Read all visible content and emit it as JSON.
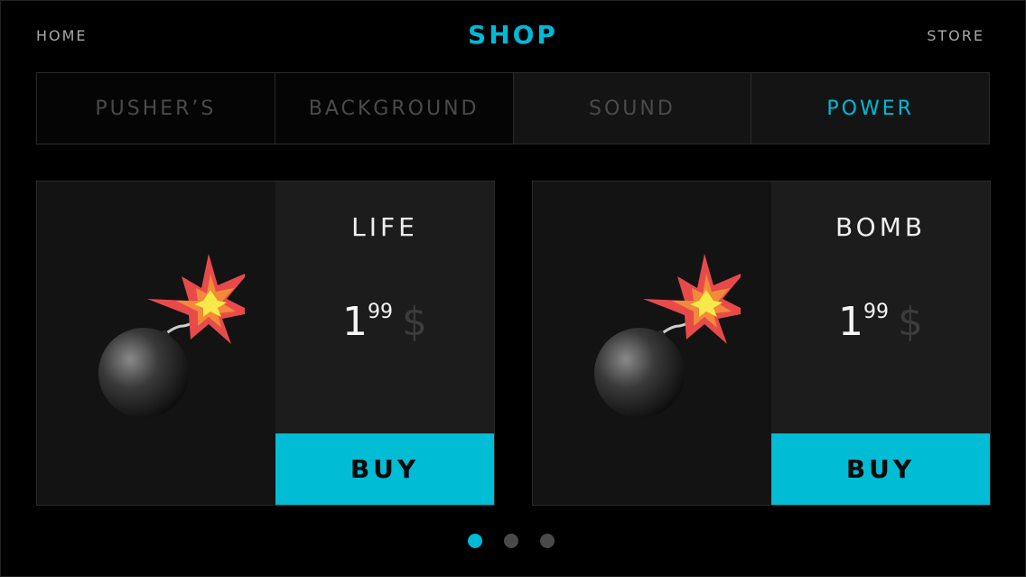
{
  "header": {
    "home_label": "HOME",
    "title": "SHOP",
    "store_label": "STORE"
  },
  "tabs": [
    {
      "label": "PUSHER’S"
    },
    {
      "label": "BACKGROUND"
    },
    {
      "label": "SOUND"
    },
    {
      "label": "POWER",
      "active": true
    }
  ],
  "products": [
    {
      "name": "LIFE",
      "price_int": "1",
      "price_cents": "99",
      "currency": "$",
      "buy_label": "BUY",
      "icon": "bomb-icon"
    },
    {
      "name": "BOMB",
      "price_int": "1",
      "price_cents": "99",
      "currency": "$",
      "buy_label": "BUY",
      "icon": "bomb-icon"
    }
  ],
  "pagination": {
    "pages": 3,
    "current": 1
  },
  "colors": {
    "accent": "#00b9d6",
    "buy": "#00bcd4",
    "background": "#000000"
  }
}
